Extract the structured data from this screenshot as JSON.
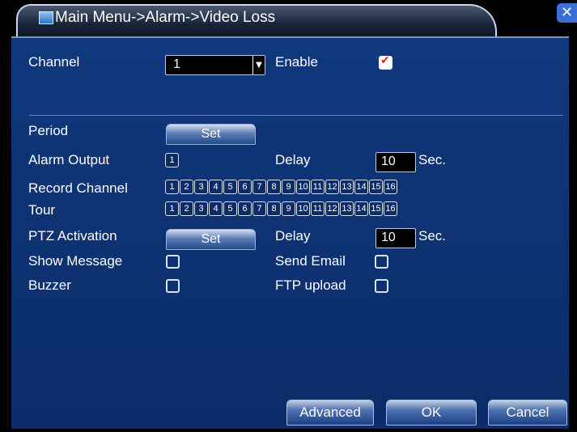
{
  "title": "Main Menu->Alarm->Video Loss",
  "close_label": "✕",
  "labels": {
    "channel": "Channel",
    "enable": "Enable",
    "period": "Period",
    "alarm_output": "Alarm Output",
    "delay": "Delay",
    "sec": "Sec.",
    "record_channel": "Record Channel",
    "tour": "Tour",
    "ptz_activation": "PTZ Activation",
    "show_message": "Show Message",
    "send_email": "Send Email",
    "buzzer": "Buzzer",
    "ftp_upload": "FTP upload"
  },
  "channel_value": "1",
  "period_button": "Set",
  "alarm_output_box": "1",
  "alarm_delay_value": "10",
  "ptz_button": "Set",
  "ptz_delay_value": "10",
  "record_channels": [
    "1",
    "2",
    "3",
    "4",
    "5",
    "6",
    "7",
    "8",
    "9",
    "10",
    "11",
    "12",
    "13",
    "14",
    "15",
    "16"
  ],
  "tour_channels": [
    "1",
    "2",
    "3",
    "4",
    "5",
    "6",
    "7",
    "8",
    "9",
    "10",
    "11",
    "12",
    "13",
    "14",
    "15",
    "16"
  ],
  "buttons": {
    "advanced": "Advanced",
    "ok": "OK",
    "cancel": "Cancel"
  }
}
